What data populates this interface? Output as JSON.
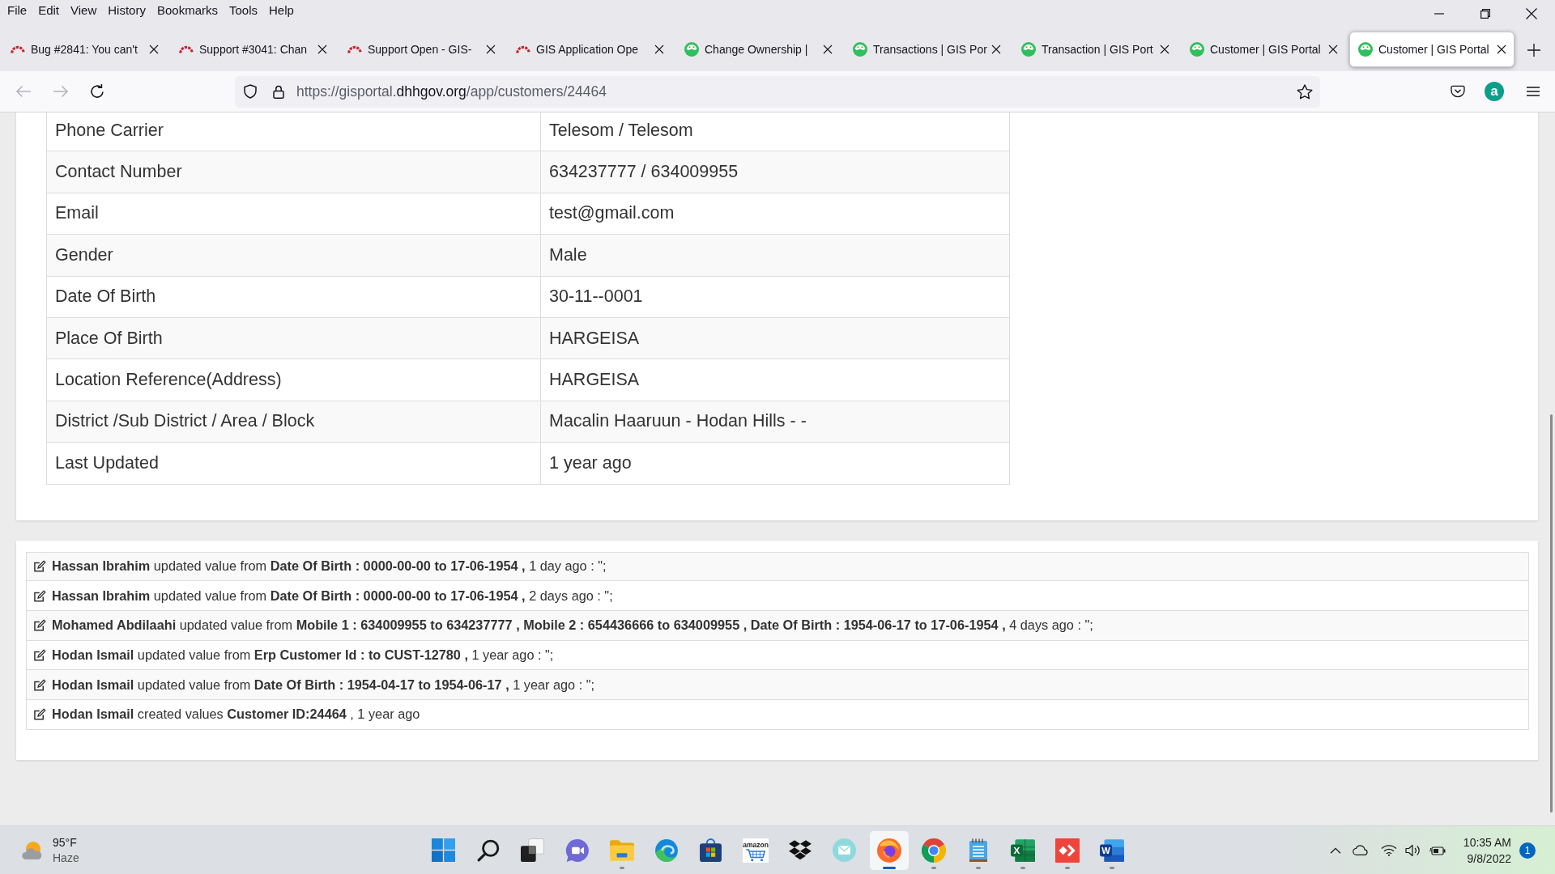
{
  "menu_bar": {
    "items": [
      "File",
      "Edit",
      "View",
      "History",
      "Bookmarks",
      "Tools",
      "Help"
    ]
  },
  "tabs": [
    {
      "title": "Bug #2841: You can't",
      "kind": "tracker",
      "selected": false
    },
    {
      "title": "Support #3041: Chan",
      "kind": "tracker",
      "selected": false
    },
    {
      "title": "Support Open - GIS-",
      "kind": "tracker",
      "selected": false
    },
    {
      "title": "GIS Application Ope",
      "kind": "tracker",
      "selected": false
    },
    {
      "title": "Change Ownership |",
      "kind": "portal",
      "selected": false
    },
    {
      "title": "Transactions | GIS Por",
      "kind": "portal",
      "selected": false
    },
    {
      "title": "Transaction | GIS Port",
      "kind": "portal",
      "selected": false
    },
    {
      "title": "Customer | GIS Portal",
      "kind": "portal",
      "selected": false
    },
    {
      "title": "Customer | GIS Portal",
      "kind": "portal",
      "selected": true
    }
  ],
  "navigation": {
    "back_disabled": true,
    "forward_disabled": true,
    "url": {
      "host_prefix": "https://gisportal.",
      "domain": "dhhgov.org",
      "path": "/app/customers/24464"
    },
    "account_letter": "a"
  },
  "details": {
    "rows": [
      {
        "label": "Phone Carrier",
        "value": "Telesom / Telesom"
      },
      {
        "label": "Contact Number",
        "value": "634237777 / 634009955"
      },
      {
        "label": "Email",
        "value": "test@gmail.com"
      },
      {
        "label": "Gender",
        "value": "Male"
      },
      {
        "label": "Date Of Birth",
        "value": "30-11--0001"
      },
      {
        "label": "Place Of Birth",
        "value": "HARGEISA"
      },
      {
        "label": "Location Reference(Address)",
        "value": "HARGEISA"
      },
      {
        "label": "District /Sub District / Area / Block",
        "value": "Macalin Haaruun - Hodan Hills - -"
      },
      {
        "label": "Last Updated",
        "value": "1 year ago"
      }
    ]
  },
  "activity_log": [
    {
      "text": "**Hassan Ibrahim** updated value from **Date Of Birth : 0000-00-00 to 17-06-1954 ,** 1 day ago : \";"
    },
    {
      "text": "**Hassan Ibrahim** updated value from **Date Of Birth : 0000-00-00 to 17-06-1954 ,** 2 days ago : \";"
    },
    {
      "text": "**Mohamed Abdilaahi** updated value from **Mobile 1 : 634009955 to 634237777 , Mobile 2 : 654436666 to 634009955 , Date Of Birth : 1954-06-17 to 17-06-1954 ,** 4 days ago : \";"
    },
    {
      "text": "**Hodan Ismail** updated value from **Erp Customer Id : to CUST-12780 ,** 1 year ago : \";"
    },
    {
      "text": "**Hodan Ismail** updated value from **Date Of Birth : 1954-04-17 to 1954-06-17 ,** 1 year ago : \";"
    },
    {
      "text": "**Hodan Ismail** created values **Customer ID:24464** , 1 year ago"
    }
  ],
  "taskbar": {
    "weather": {
      "temperature": "95°F",
      "condition": "Haze"
    },
    "apps": [
      {
        "kind": "start",
        "running": false,
        "selected": false
      },
      {
        "kind": "search",
        "running": false,
        "selected": false
      },
      {
        "kind": "task-view",
        "running": false,
        "selected": false
      },
      {
        "kind": "chat",
        "running": false,
        "selected": false
      },
      {
        "kind": "file-explorer",
        "running": true,
        "selected": false
      },
      {
        "kind": "edge",
        "running": false,
        "selected": false
      },
      {
        "kind": "store",
        "running": false,
        "selected": false
      },
      {
        "kind": "amazon",
        "logo_text": "amazon",
        "running": false,
        "selected": false
      },
      {
        "kind": "dropbox",
        "running": false,
        "selected": false
      },
      {
        "kind": "mail",
        "running": false,
        "selected": false
      },
      {
        "kind": "firefox",
        "running": true,
        "selected": true
      },
      {
        "kind": "chrome",
        "running": true,
        "selected": false
      },
      {
        "kind": "notepad",
        "running": true,
        "selected": false
      },
      {
        "kind": "excel",
        "logo_text": "X",
        "running": true,
        "selected": false
      },
      {
        "kind": "anydesk",
        "running": true,
        "selected": false
      },
      {
        "kind": "word",
        "logo_text": "W",
        "running": true,
        "selected": false
      }
    ],
    "clock": {
      "time": "10:35 AM",
      "date": "9/8/2022"
    },
    "notifications": "1"
  }
}
